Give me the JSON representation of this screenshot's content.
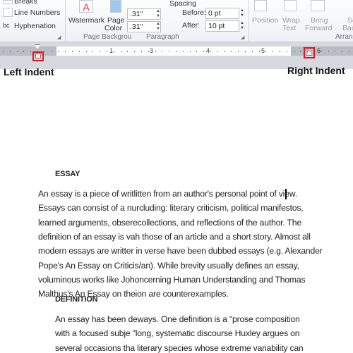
{
  "ribbon": {
    "page_setup": {
      "breaks": "Breaks",
      "line_numbers": "Line Numbers",
      "hyphenation": "Hyphenation"
    },
    "page_background": {
      "label": "Page Backgrou",
      "watermark": "Watermark",
      "page_color_1": "Page",
      "page_color_2": "Color"
    },
    "paragraph": {
      "label": "Paragraph",
      "indent_left": ".31\"",
      "indent_right": ".31\"",
      "spacing_label": "Spacing",
      "before_label": "Before:",
      "before_value": "0 pt",
      "after_label": "After:",
      "after_value": "10 pt"
    },
    "arrange": {
      "label": "Arrang",
      "position": "Position",
      "wrap_1": "Wrap",
      "wrap_2": "Text",
      "bring_1": "Bring",
      "bring_2": "Forward",
      "send_1": "Se",
      "send_2": "Backw"
    }
  },
  "ruler": {
    "numbers": [
      "1",
      "3",
      "4",
      "5",
      "6"
    ]
  },
  "callouts": {
    "left": "Left Indent",
    "right": "Right Indent"
  },
  "document": {
    "heading1": "ESSAY",
    "para1": [
      "An essay is a piece of writlitten from an author's personal point of view.",
      "Essays can consist of a nurcluding: literary criticism, political manifestos,",
      "learned arguments, obserecollections, and reflections of the author. The",
      "definition of an essay is vah those of an article and a short story. Almost all",
      "modern essays are writter in verse have been dubbed essays (e.g. Alexander",
      "Pope's An Essay on Criticis/an). While brevity usually defines an essay,",
      "voluminous works like Johoncerning Human Understanding and Thomas",
      "Malthus's An Essay on theion are counterexamples."
    ],
    "heading2": "DEFINITION",
    "para2": [
      "An essay has been deways. One definition is a \"prose composition",
      "with a focused subje \"long, systematic discourse Huxley argues on",
      "several occasions tha literary species whose extreme variability can"
    ]
  },
  "colors": {
    "callout_box": "#e0151f",
    "ruler_gray": "#b8bcc3"
  }
}
